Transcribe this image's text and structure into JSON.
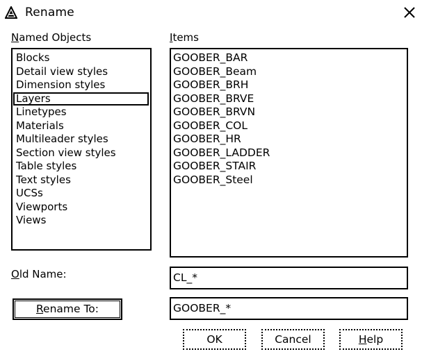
{
  "window": {
    "title": "Rename",
    "icon": "autocad-triangle-icon",
    "close_icon": "close-icon"
  },
  "named_objects": {
    "label": "Named Objects",
    "label_accel": "N",
    "label_rest": "amed Objects",
    "items": [
      {
        "label": "Blocks",
        "selected": false
      },
      {
        "label": "Detail view styles",
        "selected": false
      },
      {
        "label": "Dimension styles",
        "selected": false
      },
      {
        "label": "Layers",
        "selected": true
      },
      {
        "label": "Linetypes",
        "selected": false
      },
      {
        "label": "Materials",
        "selected": false
      },
      {
        "label": "Multileader styles",
        "selected": false
      },
      {
        "label": "Section view styles",
        "selected": false
      },
      {
        "label": "Table styles",
        "selected": false
      },
      {
        "label": "Text styles",
        "selected": false
      },
      {
        "label": "UCSs",
        "selected": false
      },
      {
        "label": "Viewports",
        "selected": false
      },
      {
        "label": "Views",
        "selected": false
      }
    ]
  },
  "items_panel": {
    "label": "Items",
    "label_accel": "I",
    "label_rest": "tems",
    "items": [
      "GOOBER_BAR",
      "GOOBER_Beam",
      "GOOBER_BRH",
      "GOOBER_BRVE",
      "GOOBER_BRVN",
      "GOOBER_COL",
      "GOOBER_HR",
      "GOOBER_LADDER",
      "GOOBER_STAIR",
      "GOOBER_Steel"
    ]
  },
  "old_name": {
    "label": "Old Name:",
    "label_accel": "O",
    "label_rest": "ld Name:",
    "value": "CL_*"
  },
  "rename_to": {
    "button_label": "Rename To:",
    "label_accel": "R",
    "label_rest": "ename To:",
    "value": "GOOBER_*"
  },
  "buttons": {
    "ok": "OK",
    "cancel": "Cancel",
    "help": "Help",
    "help_accel": "H",
    "help_rest": "elp"
  }
}
